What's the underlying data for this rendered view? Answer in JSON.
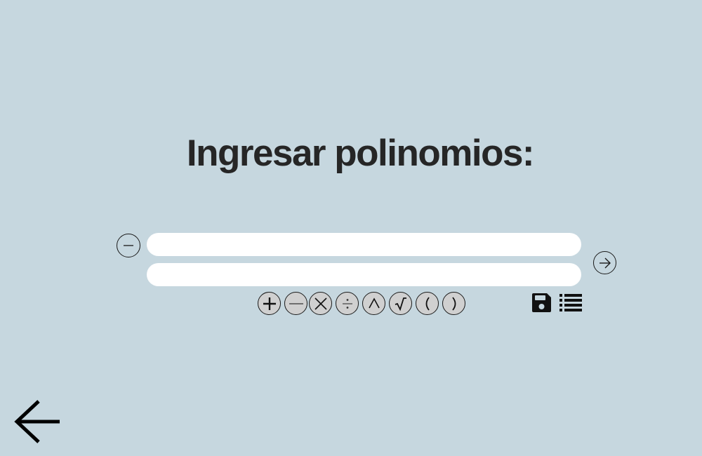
{
  "title": "Ingresar polinomios:",
  "inputs": [
    {
      "value": "",
      "placeholder": ""
    },
    {
      "value": "",
      "placeholder": ""
    }
  ],
  "icons": {
    "remove": "minus-circle-icon",
    "submit": "arrow-right-circle-icon",
    "save": "save-icon",
    "list": "list-icon",
    "back": "arrow-left-icon"
  },
  "operators": [
    "+",
    "−",
    "×",
    "÷",
    "^",
    "√",
    "(",
    ")"
  ],
  "colors": {
    "background": "#c6d7df",
    "title": "#262626",
    "input": "#ffffff",
    "operator_button": "#d0d0d0"
  }
}
